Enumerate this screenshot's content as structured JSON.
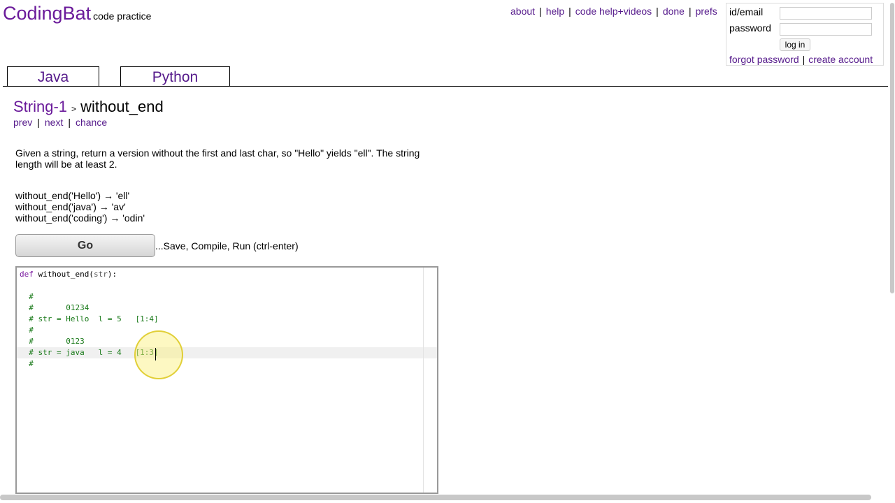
{
  "brand": {
    "logo": "CodingBat",
    "tagline": "code practice"
  },
  "topnav": [
    "about",
    "help",
    "code help+videos",
    "done",
    "prefs"
  ],
  "login": {
    "email_label": "id/email",
    "password_label": "password",
    "button": "log in",
    "forgot": "forgot password",
    "create": "create account"
  },
  "tabs": {
    "java": "Java",
    "python": "Python"
  },
  "crumb": {
    "section": "String-1",
    "arrow": ">",
    "problem": "without_end"
  },
  "pnc": {
    "prev": "prev",
    "next": "next",
    "chance": "chance"
  },
  "description": "Given a string, return a version without the first and last char, so \"Hello\" yields \"ell\". The string length will be at least 2.",
  "examples": [
    "without_end('Hello') → 'ell'",
    "without_end('java') → 'av'",
    "without_end('coding') → 'odin'"
  ],
  "go": {
    "label": "Go",
    "hint": "...Save, Compile, Run (ctrl-enter)"
  },
  "code": {
    "def_kw": "def",
    "func": " without_end(",
    "param": "str",
    "close": "):",
    "comments": [
      "  #",
      "  #       01234",
      "  # str = Hello  l = 5   [1:4]",
      "  #",
      "  #       0123",
      "  # str = java   l = 4   [1:3]",
      "  #"
    ]
  }
}
